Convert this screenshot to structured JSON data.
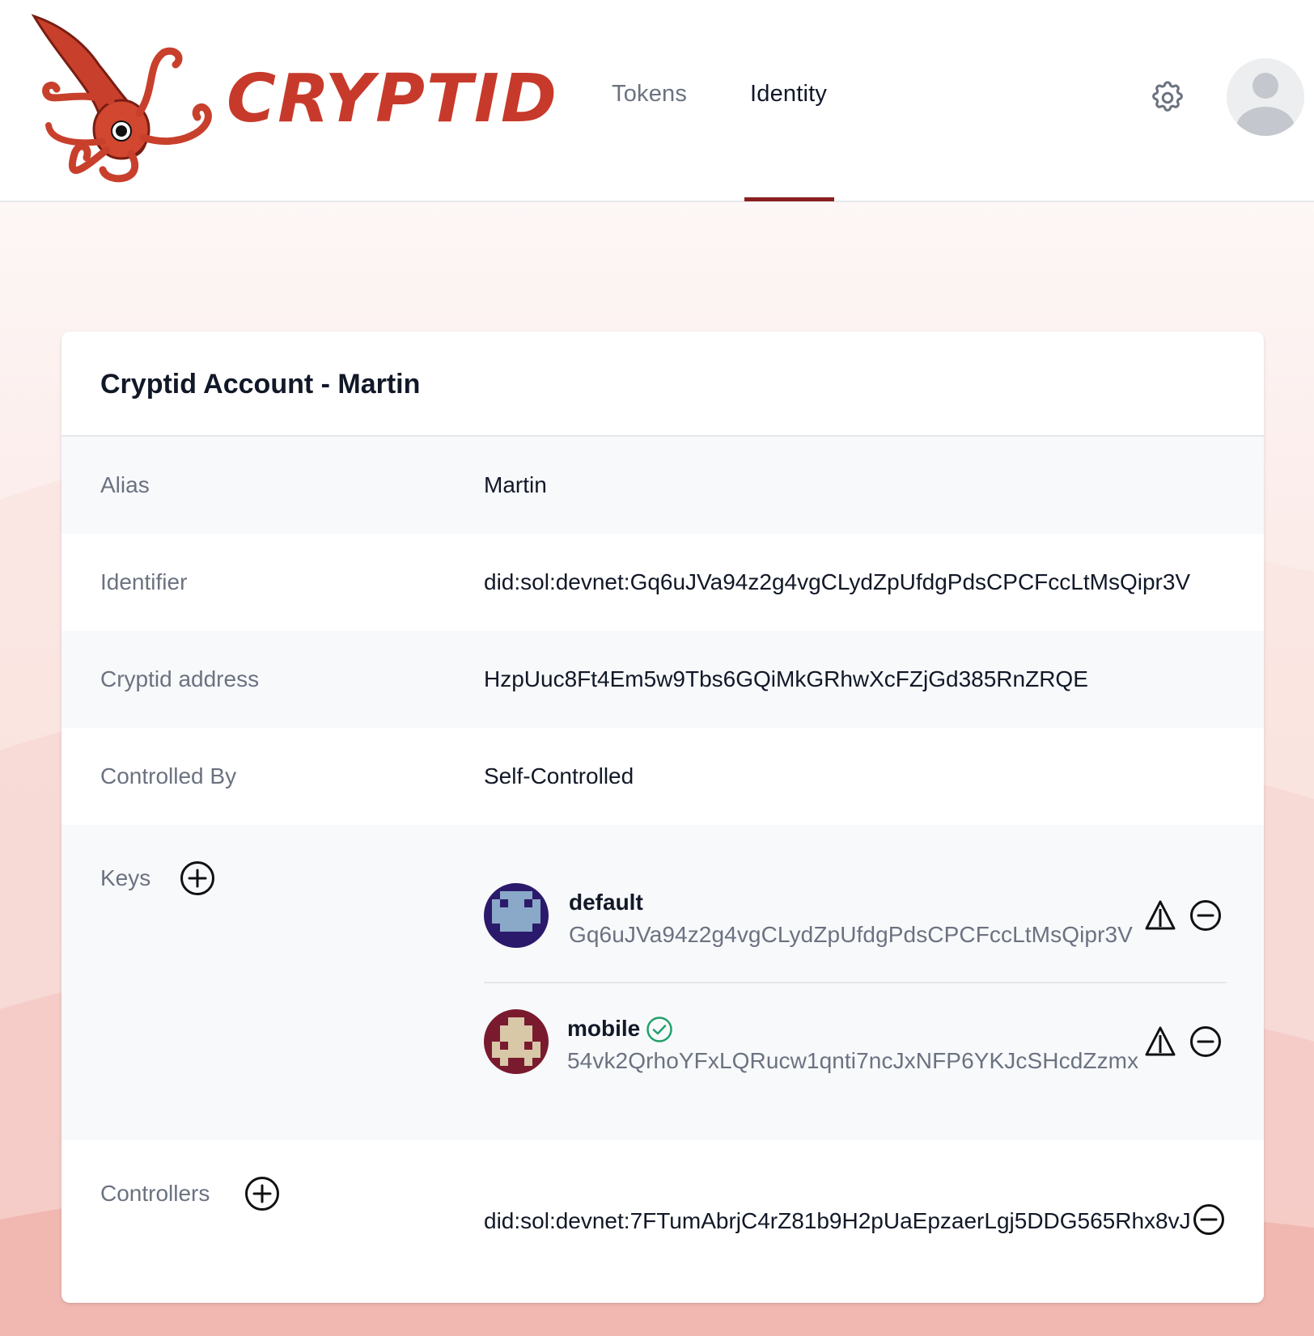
{
  "header": {
    "logo_text": "CRYPTID",
    "nav": {
      "tokens_label": "Tokens",
      "identity_label": "Identity"
    }
  },
  "card": {
    "title": "Cryptid Account - Martin",
    "rows": {
      "alias": {
        "label": "Alias",
        "value": "Martin"
      },
      "identifier": {
        "label": "Identifier",
        "value": "did:sol:devnet:Gq6uJVa94z2g4vgCLydZpUfdgPdsCPCFccLtMsQipr3V"
      },
      "address": {
        "label": "Cryptid address",
        "value": "HzpUuc8Ft4Em5w9Tbs6GQiMkGRhwXcFZjGd385RnZRQE"
      },
      "controlled_by": {
        "label": "Controlled By",
        "value": "Self-Controlled"
      }
    },
    "keys": {
      "label": "Keys",
      "items": [
        {
          "name": "default",
          "address": "Gq6uJVa94z2g4vgCLydZpUfdgPdsCPCFccLtMsQipr3V",
          "verified": false,
          "avatar_color": "#2b1a6b"
        },
        {
          "name": "mobile",
          "address": "54vk2QrhoYFxLQRucw1qnti7ncJxNFP6YKJcSHcdZzmx",
          "verified": true,
          "avatar_color": "#7a1a2e"
        }
      ]
    },
    "controllers": {
      "label": "Controllers",
      "items": [
        {
          "value": "did:sol:devnet:7FTumAbrjC4rZ81b9H2pUaEpzaerLgj5DDG565Rhx8vJ"
        }
      ]
    }
  },
  "colors": {
    "brand_red": "#c73a2b",
    "active_underline": "#8b1f1f",
    "verified_green": "#22a06b"
  },
  "icons": [
    "squid-logo",
    "gear-icon",
    "user-avatar-icon",
    "plus-circle-icon",
    "warning-triangle-icon",
    "minus-circle-icon",
    "check-circle-icon"
  ]
}
